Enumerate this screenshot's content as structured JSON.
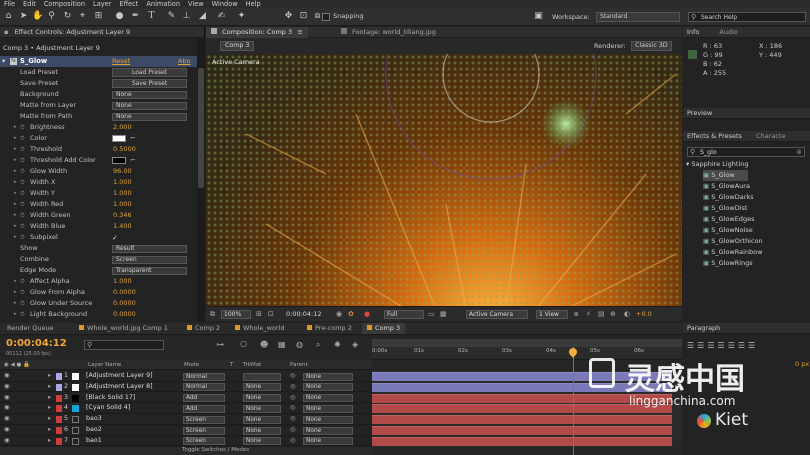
{
  "menu": [
    "File",
    "Edit",
    "Composition",
    "Layer",
    "Effect",
    "Animation",
    "View",
    "Window",
    "Help"
  ],
  "toolbar": {
    "snapping": "Snapping",
    "workspace_label": "Workspace:",
    "workspace_value": "Standard",
    "search_placeholder": "Search Help"
  },
  "effect_controls": {
    "tab": "Effect Controls: Adjustment Layer 9",
    "breadcrumb": "Comp 3 • Adjustment Layer 9",
    "effect_name": "S_Glow",
    "reset": "Reset",
    "about": "Abo",
    "load_preset_label": "Load Preset",
    "load_preset_btn": "Load Preset",
    "save_preset_label": "Save Preset",
    "save_preset_btn": "Save Preset",
    "rows": [
      {
        "label": "Background",
        "value": "None",
        "kind": "select"
      },
      {
        "label": "Matte from Layer",
        "value": "None",
        "kind": "select"
      },
      {
        "label": "Matte from Path",
        "value": "None",
        "kind": "select"
      },
      {
        "label": "Brightness",
        "value": "2.000",
        "kind": "num"
      },
      {
        "label": "Color",
        "value": "",
        "kind": "color",
        "color": "#ffffff"
      },
      {
        "label": "Threshold",
        "value": "0.5000",
        "kind": "num"
      },
      {
        "label": "Threshold Add Color",
        "value": "",
        "kind": "color",
        "color": "#000000"
      },
      {
        "label": "Glow Width",
        "value": "96.00",
        "kind": "num"
      },
      {
        "label": "Width X",
        "value": "1.000",
        "kind": "num"
      },
      {
        "label": "Width Y",
        "value": "1.000",
        "kind": "num"
      },
      {
        "label": "Width Red",
        "value": "1.000",
        "kind": "num"
      },
      {
        "label": "Width Green",
        "value": "0.346",
        "kind": "num"
      },
      {
        "label": "Width Blue",
        "value": "1.400",
        "kind": "num"
      },
      {
        "label": "Subpixel",
        "value": "✓",
        "kind": "check"
      },
      {
        "label": "Show",
        "value": "Result",
        "kind": "select"
      },
      {
        "label": "Combine",
        "value": "Screen",
        "kind": "select"
      },
      {
        "label": "Edge Mode",
        "value": "Transparent",
        "kind": "select"
      },
      {
        "label": "Affect Alpha",
        "value": "1.000",
        "kind": "num"
      },
      {
        "label": "Glow From Alpha",
        "value": "0.0000",
        "kind": "num"
      },
      {
        "label": "Glow Under Source",
        "value": "0.0000",
        "kind": "num"
      },
      {
        "label": "Light Background",
        "value": "0.0000",
        "kind": "num"
      }
    ]
  },
  "composition": {
    "tab": "Composition: Comp 3",
    "footage_tab": "Footage: world_tiliang.jpg",
    "subtab": "Comp 3",
    "renderer_label": "Renderer:",
    "renderer_value": "Classic 3D",
    "active_camera": "Active Camera",
    "footer": {
      "zoom": "100%",
      "time": "0:00:04:12",
      "resolution": "Full",
      "camera": "Active Camera",
      "view": "1 View",
      "exposure": "+0.0"
    }
  },
  "info": {
    "tab": "Info",
    "audio_tab": "Audio",
    "r": "R : 63",
    "g": "G : 99",
    "b": "B : 62",
    "a": "A : 255",
    "x": "X : 186",
    "y": "Y : 449",
    "swatch": "#3f633e"
  },
  "preview": {
    "tab": "Preview"
  },
  "effects_presets": {
    "tab": "Effects & Presets",
    "char_tab": "Characte",
    "search": "S_glo",
    "category": "Sapphire Lighting",
    "items": [
      "S_Glow",
      "S_GlowAura",
      "S_GlowDarks",
      "S_GlowDist",
      "S_GlowEdges",
      "S_GlowNoise",
      "S_GlowOrthicon",
      "S_GlowRainbow",
      "S_GlowRings"
    ]
  },
  "paragraph": {
    "tab": "Paragraph",
    "px": "0 px"
  },
  "timeline": {
    "tabs": [
      "Render Queue",
      "Whole_world.jpg Comp 1",
      "Comp 2",
      "Whole_world",
      "Pre-comp 2",
      "Comp 3"
    ],
    "timecode": "0:00:04:12",
    "fps": "00112 (25.00 fps)",
    "ruler": [
      "0:00s",
      "01s",
      "02s",
      "03s",
      "04s",
      "05s",
      "06s"
    ],
    "headers": {
      "layer_name": "Layer Name",
      "mode": "Mode",
      "t": "T",
      "trkmat": "TrkMat",
      "parent": "Parent"
    },
    "layers": [
      {
        "num": "1",
        "name": "[Adjustment Layer 9]",
        "color": "#ffffff",
        "chip": "#a9a9e6",
        "mode": "Normal",
        "trk": "",
        "parent": "None",
        "bar": "#7a7ab8"
      },
      {
        "num": "2",
        "name": "[Adjustment Layer 8]",
        "color": "#ffffff",
        "chip": "#a9a9e6",
        "mode": "Normal",
        "trk": "None",
        "parent": "None",
        "bar": "#7a7ab8"
      },
      {
        "num": "3",
        "name": "[Black Solid 17]",
        "color": "#000000",
        "chip": "#d23c3c",
        "mode": "Add",
        "trk": "None",
        "parent": "None",
        "bar": "#b24a4a"
      },
      {
        "num": "4",
        "name": "[Cyan Solid 4]",
        "color": "#12a3d6",
        "chip": "#d23c3c",
        "mode": "Add",
        "trk": "None",
        "parent": "None",
        "bar": "#b24a4a"
      },
      {
        "num": "5",
        "name": "bao3",
        "color": "",
        "chip": "#d23c3c",
        "mode": "Screen",
        "trk": "None",
        "parent": "None",
        "bar": "#b24a4a"
      },
      {
        "num": "6",
        "name": "bao2",
        "color": "",
        "chip": "#d23c3c",
        "mode": "Screen",
        "trk": "None",
        "parent": "None",
        "bar": "#b24a4a"
      },
      {
        "num": "7",
        "name": "bao1",
        "color": "",
        "chip": "#d23c3c",
        "mode": "Screen",
        "trk": "None",
        "parent": "None",
        "bar": "#b24a4a"
      }
    ],
    "toggle": "Toggle Switches / Modes"
  },
  "watermark": {
    "cn": "灵感中国",
    "url": "lingganchina.com",
    "brand": "Kiet"
  }
}
